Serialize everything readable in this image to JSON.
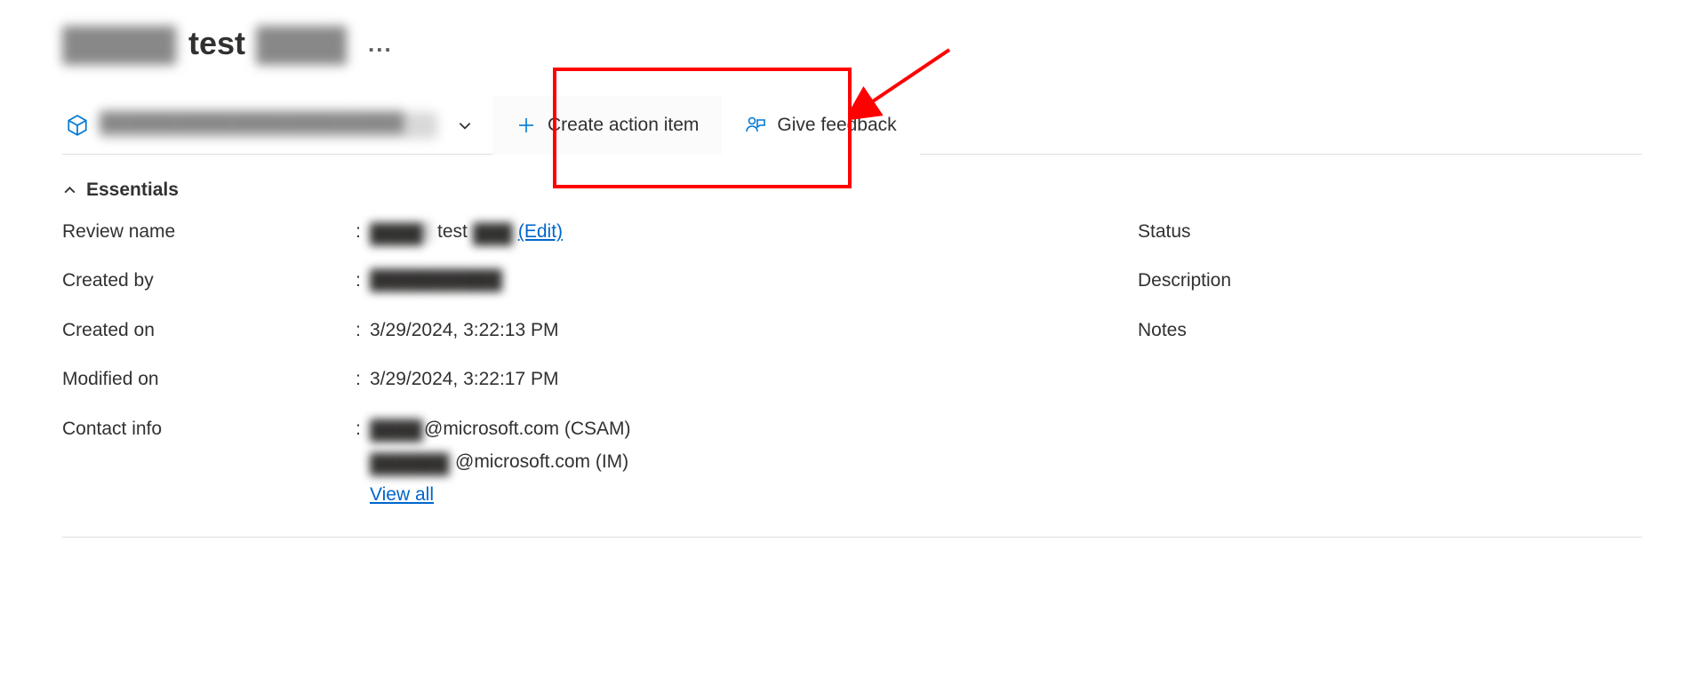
{
  "header": {
    "title_prefix_redacted": "█████",
    "title_middle": "test",
    "title_suffix_redacted": "████",
    "more_label": "..."
  },
  "commandbar": {
    "dropdown_redacted": "███████████████████████",
    "create_action_item": "Create action item",
    "give_feedback": "Give feedback"
  },
  "essentials": {
    "header": "Essentials",
    "left": {
      "review_name": {
        "label": "Review name",
        "value_prefix_redacted": "████",
        "value_mid": "test",
        "value_suffix_redacted": "███",
        "edit_label": "(Edit)"
      },
      "created_by": {
        "label": "Created by",
        "value_redacted": "██████████"
      },
      "created_on": {
        "label": "Created on",
        "value": "3/29/2024, 3:22:13 PM"
      },
      "modified_on": {
        "label": "Modified on",
        "value": "3/29/2024, 3:22:17 PM"
      },
      "contact_info": {
        "label": "Contact info",
        "line1_redacted": "████",
        "line1_suffix": "@microsoft.com (CSAM)",
        "line2_redacted": "██████",
        "line2_suffix": "@microsoft.com (IM)",
        "view_all": "View all"
      }
    },
    "right": {
      "status": {
        "label": "Status"
      },
      "description": {
        "label": "Description"
      },
      "notes": {
        "label": "Notes"
      }
    }
  }
}
